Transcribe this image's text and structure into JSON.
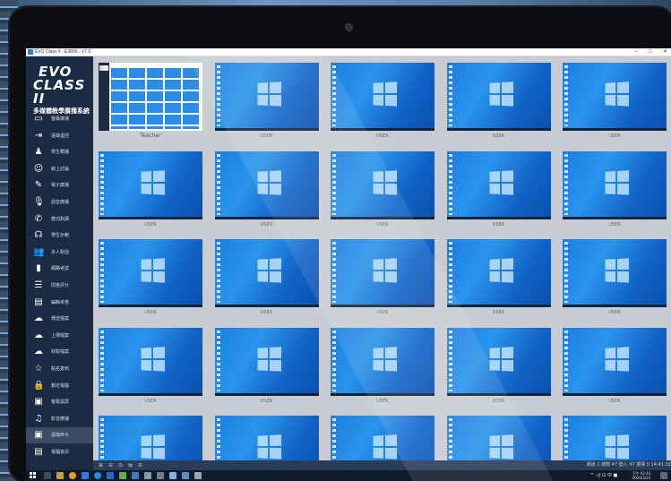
{
  "window": {
    "title": "EVO Class II - E3856 - V7.0",
    "controls": [
      "–",
      "□",
      "✕"
    ]
  },
  "logo": {
    "line1": "EVO",
    "line2": "CLASS II",
    "line3": "多媒體教學廣播系統"
  },
  "sidebar": {
    "items": [
      {
        "label": "螢幕廣播",
        "icon": "monitor-icon",
        "glyph": "▭"
      },
      {
        "label": "遠端遙控",
        "icon": "remote-login-icon",
        "glyph": "⇥"
      },
      {
        "label": "學生轉播",
        "icon": "student-person-icon",
        "glyph": "♟"
      },
      {
        "label": "線上討論",
        "icon": "smiley-icon",
        "glyph": "☺"
      },
      {
        "label": "電子廣播",
        "icon": "pen-icon",
        "glyph": "✎"
      },
      {
        "label": "語音廣播",
        "icon": "microphone-icon",
        "glyph": "🎙"
      },
      {
        "label": "雙向對講",
        "icon": "phone-icon",
        "glyph": "✆"
      },
      {
        "label": "學生示範",
        "icon": "speaker-person-icon",
        "glyph": "☊"
      },
      {
        "label": "多人對話",
        "icon": "group-icon",
        "glyph": "👥"
      },
      {
        "label": "網路考試",
        "icon": "bar-chart-icon",
        "glyph": "▮"
      },
      {
        "label": "問卷評分",
        "icon": "checklist-icon",
        "glyph": "☰"
      },
      {
        "label": "編輯考卷",
        "icon": "document-icon",
        "glyph": "▤"
      },
      {
        "label": "傳送檔案",
        "icon": "cloud-upload-icon",
        "glyph": "☁"
      },
      {
        "label": "上傳檔案",
        "icon": "cloud-download-icon",
        "glyph": "☁"
      },
      {
        "label": "收取檔案",
        "icon": "cloud-check-icon",
        "glyph": "☁"
      },
      {
        "label": "點名簽到",
        "icon": "star-icon",
        "glyph": "☆"
      },
      {
        "label": "鎖定電腦",
        "icon": "lock-icon",
        "glyph": "🔒"
      },
      {
        "label": "螢幕黑屏",
        "icon": "image-icon",
        "glyph": "▣"
      },
      {
        "label": "影音廣播",
        "icon": "music-icon",
        "glyph": "♫"
      },
      {
        "label": "遠端命令",
        "icon": "terminal-icon",
        "glyph": "▣",
        "active": true
      },
      {
        "label": "電腦資訊",
        "icon": "message-icon",
        "glyph": "▤"
      }
    ]
  },
  "grid": {
    "tiles": [
      {
        "caption": "Teacher",
        "kind": "teacher"
      },
      {
        "caption": "USER"
      },
      {
        "caption": "USER"
      },
      {
        "caption": "USER"
      },
      {
        "caption": "USER"
      },
      {
        "caption": "USER"
      },
      {
        "caption": "USER"
      },
      {
        "caption": "USER"
      },
      {
        "caption": "USER"
      },
      {
        "caption": "USER"
      },
      {
        "caption": "USER"
      },
      {
        "caption": "USER"
      },
      {
        "caption": "USER"
      },
      {
        "caption": "USER"
      },
      {
        "caption": "USER"
      },
      {
        "caption": "USER"
      },
      {
        "caption": "USER"
      },
      {
        "caption": "USER"
      },
      {
        "caption": "USER"
      },
      {
        "caption": "USER"
      },
      {
        "caption": ""
      },
      {
        "caption": ""
      },
      {
        "caption": ""
      },
      {
        "caption": ""
      },
      {
        "caption": ""
      }
    ]
  },
  "statusbar": {
    "tools": [
      "⊕",
      "⊖",
      "⊙",
      "⇆",
      "⊘"
    ],
    "text": "頻道 1   總數 47   登入 47   選擇 0   14:41:32"
  },
  "taskbar": {
    "tray_text": "^  ◁)  ⊡  中  ■",
    "clock_time": "下午 02:41",
    "clock_date": "2020/3/20"
  },
  "colors": {
    "sidebar_bg": "#1b2b44",
    "desktop_blue": "#1a7ee0",
    "grid_bg": "#c9cdd3"
  }
}
